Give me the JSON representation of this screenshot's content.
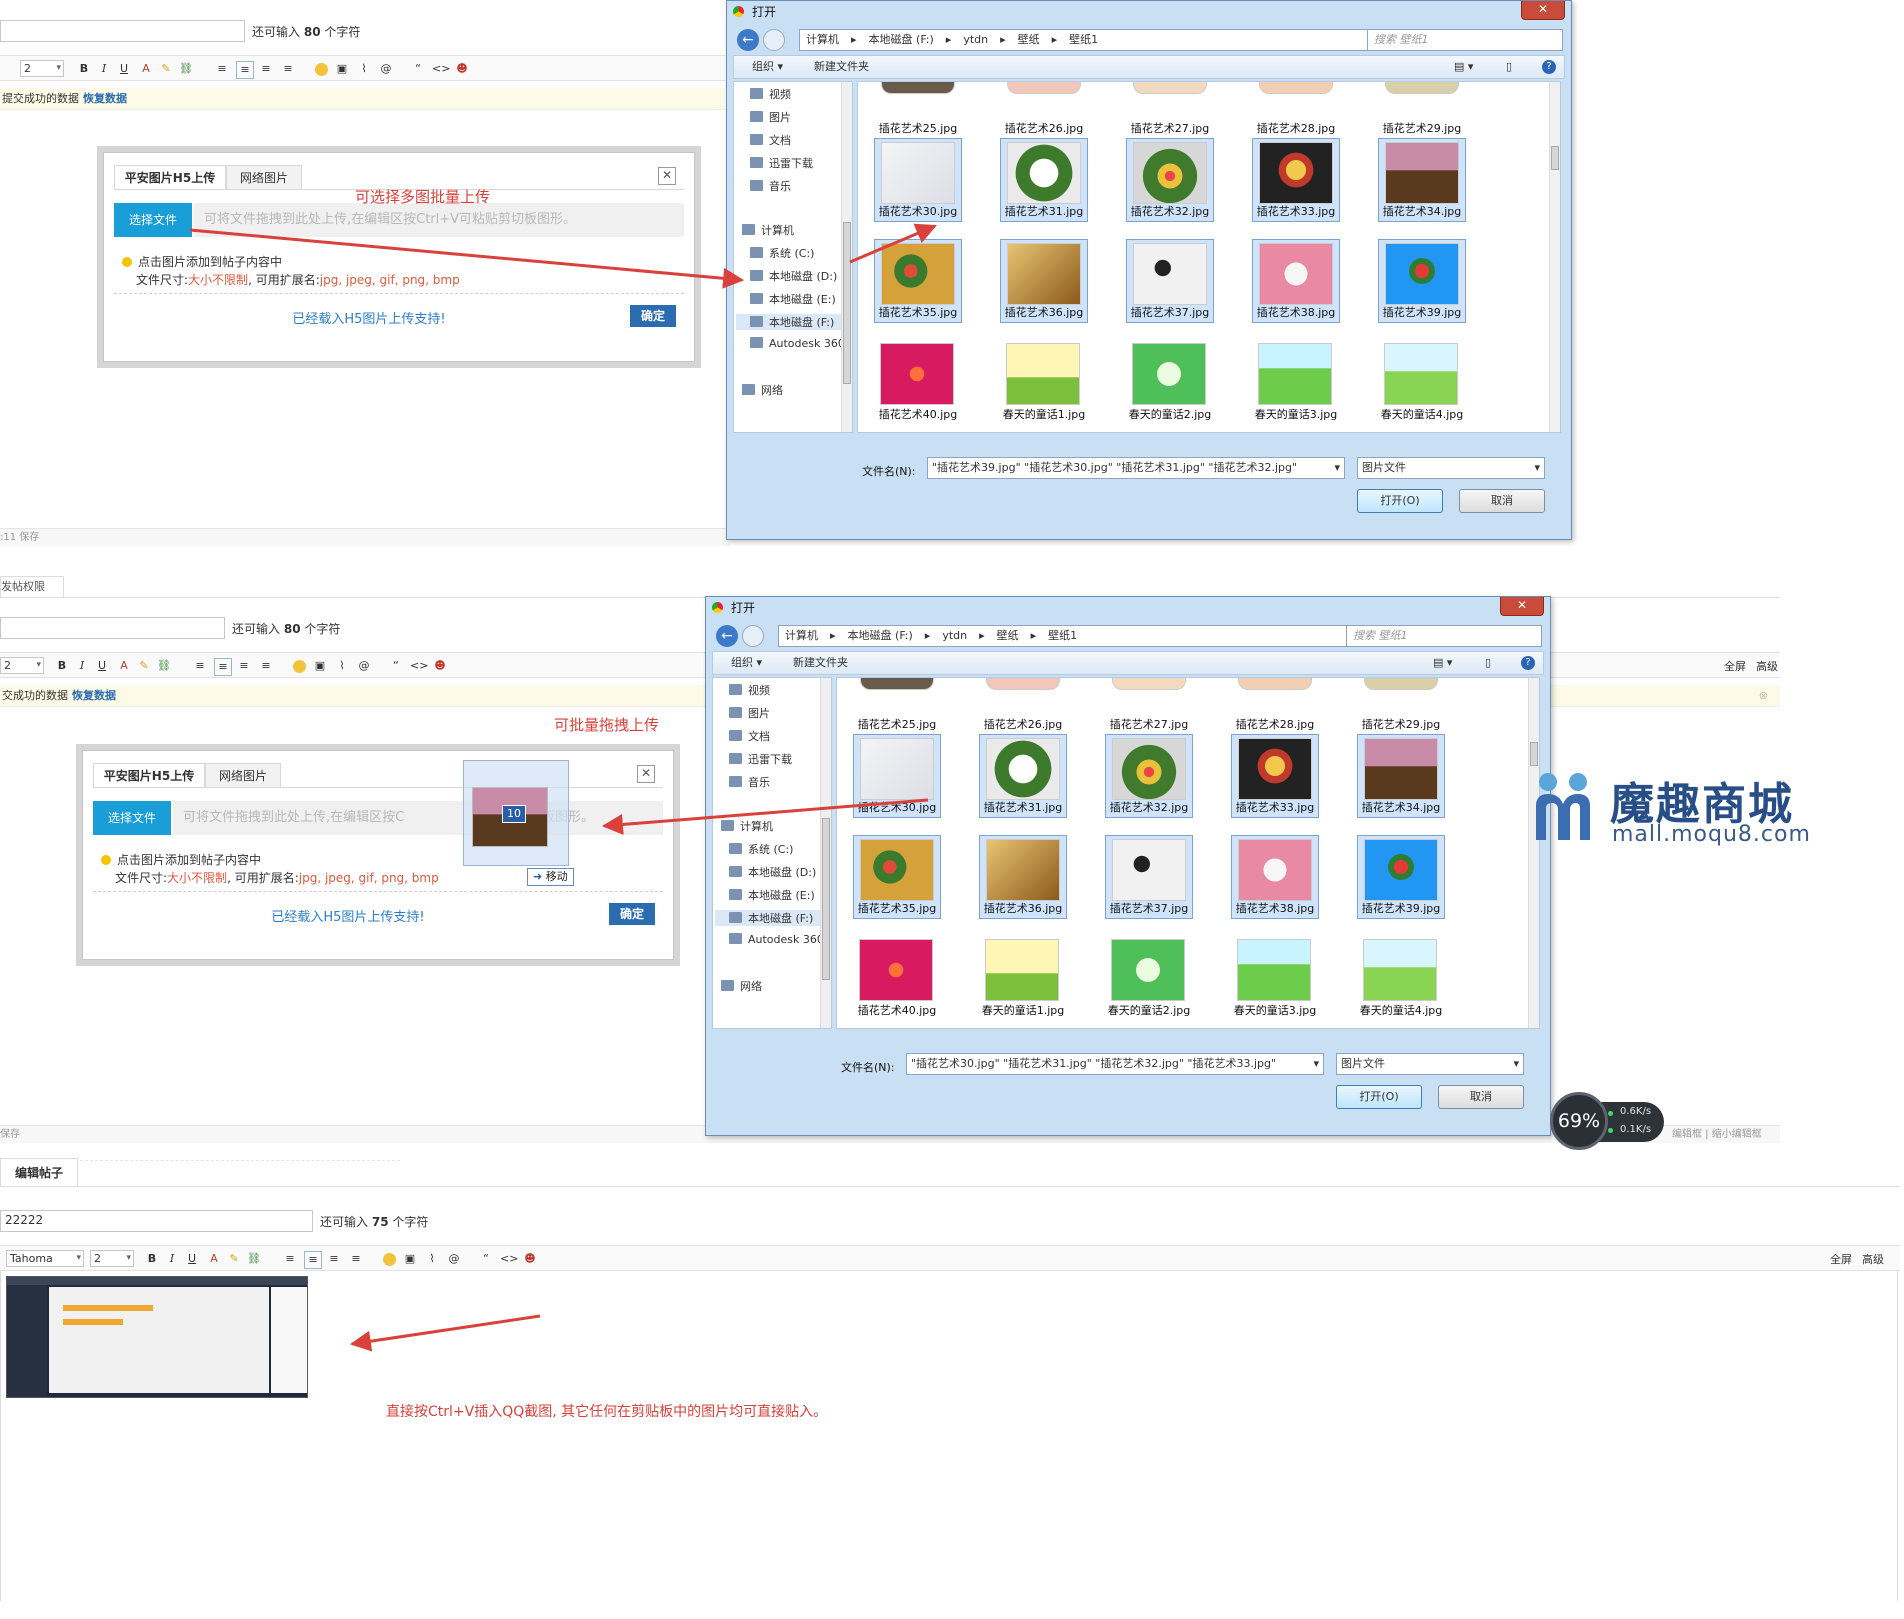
{
  "editor_common": {
    "char_hint_prefix": "还可输入",
    "char_hint_suffix": "个字符",
    "font_size": "2",
    "font_family": "Tahoma",
    "bold": "B",
    "italic": "I",
    "underline": "U",
    "quote": "“",
    "code": "<>",
    "fullscreen": "全屏",
    "advanced": "高级"
  },
  "editor1": {
    "chars_left": "80",
    "restore_text": "提交成功的数据",
    "restore_link": "恢复数据",
    "status_left": ":11 保存"
  },
  "editor2": {
    "chars_left": "80",
    "tab_partial": "发帖权限",
    "restore_text": "交成功的数据",
    "restore_link": "恢复数据",
    "status_left": "保存",
    "status_right": "编辑框 | 缩小编辑框"
  },
  "editor3": {
    "tab_label": "编辑帖子",
    "title_value": "22222",
    "chars_left": "75"
  },
  "upload_dialog": {
    "tab_h5": "平安图片H5上传",
    "tab_net": "网络图片",
    "choose_button": "选择文件",
    "drop_hint": "可将文件拖拽到此处上传,在编辑区按Ctrl+V可粘贴剪切板图形。",
    "drop_hint_short": "可将文件拖拽到此处上传,在编辑区按C",
    "drop_hint_tail": "切板图形。",
    "tip1": "点击图片添加到帖子内容中",
    "tip2_prefix": "文件尺寸:",
    "tip2_size": "大小不限制",
    "tip2_mid": ", 可用扩展名:",
    "tip2_ext": "jpg, jpeg, gif, png, bmp",
    "h5_support": "已经载入H5图片上传支持!",
    "ok_button": "确定",
    "close": "✕"
  },
  "annotations": {
    "multi_select": "可选择多图批量上传",
    "drag_upload": "可批量拖拽上传",
    "paste": "直接按Ctrl+V插入QQ截图, 其它任何在剪贴板中的图片均可直接贴入。"
  },
  "drag_ghost": {
    "count": "10",
    "label": "移动"
  },
  "file_dialog": {
    "title": "打开",
    "close": "✕",
    "breadcrumb": [
      "计算机",
      "本地磁盘 (F:)",
      "ytdn",
      "壁纸",
      "壁纸1"
    ],
    "search_placeholder": "搜索 壁纸1",
    "organize": "组织 ▾",
    "new_folder": "新建文件夹",
    "help": "?",
    "nav_items": [
      "视频",
      "图片",
      "文档",
      "迅雷下载",
      "音乐",
      "计算机",
      "系统 (C:)",
      "本地磁盘 (D:)",
      "本地磁盘 (E:)",
      "本地磁盘 (F:)",
      "Autodesk 360",
      "网络"
    ],
    "top_row": [
      "插花艺术25.jpg",
      "插花艺术26.jpg",
      "插花艺术27.jpg",
      "插花艺术28.jpg",
      "插花艺术29.jpg"
    ],
    "row1": [
      "插花艺术30.jpg",
      "插花艺术31.jpg",
      "插花艺术32.jpg",
      "插花艺术33.jpg",
      "插花艺术34.jpg"
    ],
    "row2": [
      "插花艺术35.jpg",
      "插花艺术36.jpg",
      "插花艺术37.jpg",
      "插花艺术38.jpg",
      "插花艺术39.jpg"
    ],
    "row3": [
      "插花艺术40.jpg",
      "春天的童话1.jpg",
      "春天的童话2.jpg",
      "春天的童话3.jpg",
      "春天的童话4.jpg"
    ],
    "filename_label": "文件名(N):",
    "filename_value_1": "\"插花艺术39.jpg\" \"插花艺术30.jpg\" \"插花艺术31.jpg\" \"插花艺术32.jpg\"",
    "filename_value_2": "\"插花艺术30.jpg\" \"插花艺术31.jpg\" \"插花艺术32.jpg\" \"插花艺术33.jpg\"",
    "filetype": "图片文件",
    "open_button": "打开(O)",
    "cancel_button": "取消"
  },
  "watermark": {
    "brand": "魔趣商城",
    "url": "mall.moqu8.com"
  },
  "speed_widget": {
    "percent": "69%",
    "up": "0.6K/s",
    "down": "0.1K/s"
  },
  "colors": {
    "annotation_red": "#d9413a",
    "accent_blue": "#1a9ed8",
    "link_blue": "#2b7fc8"
  }
}
